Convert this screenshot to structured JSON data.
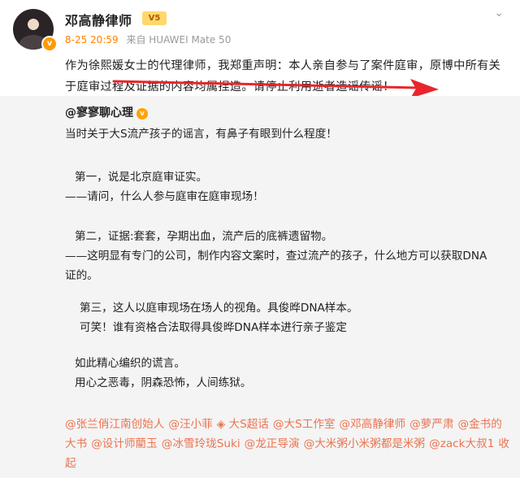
{
  "post": {
    "author": "邓高静律师",
    "vip_badge": "V5",
    "verified_mark": "v",
    "time": "8-25 20:59",
    "source": "来自 HUAWEI Mate 50",
    "menu_icon": "chevron-down-icon",
    "statement": "作为徐熙媛女士的代理律师，我郑重声明：本人亲自参与了案件庭审，原博中所有关于庭审过程及证据的内容均属捏造。请停止利用逝者造谣传谣！"
  },
  "repost": {
    "author": "@寥寥聊心理",
    "verified_mark": "v",
    "lines": [
      "当时关于大S流产孩子的谣言，有鼻子有眼到什么程度！",
      "第一，说是北京庭审证实。",
      "——请问，什么人参与庭审在庭审现场！",
      "第二，证据:套套，孕期出血，流产后的底裤遗留物。",
      "——这明显有专门的公司，制作内容文案时，查过流产的孩子，什么地方可以获取DNA",
      "证的。",
      "第三，这人以庭审现场在场人的视角。具俊晔DNA样本。",
      "可笑！谁有资格合法取得具俊晔DNA样本进行亲子鉴定",
      "如此精心编织的谎言。",
      "用心之恶毒，阴森恐怖，人间练狱。"
    ],
    "mentions": [
      "@张兰俏江南创始人",
      "@汪小菲",
      "◈ 大S超话",
      "@大S工作室",
      "@邓高静律师",
      "@萝严肃",
      "@金书的大书",
      "@设计师藺玉",
      "@冰雪玲珑Suki",
      "@龙正导演",
      "@大米粥小米粥都是米粥",
      "@zack大叔1",
      "收起"
    ]
  },
  "colors": {
    "accent": "#ff8200",
    "mention": "#eb7350",
    "arrow": "#e8262c",
    "repost_bg": "#f4f4f4"
  }
}
